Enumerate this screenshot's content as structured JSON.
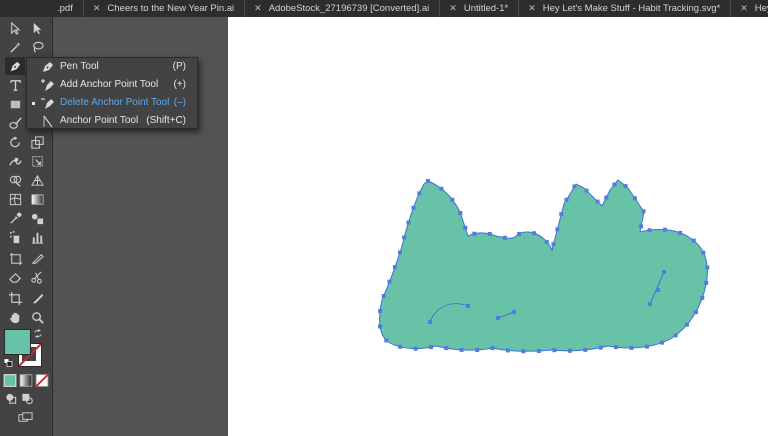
{
  "tabs": [
    {
      "label": ".pdf"
    },
    {
      "label": "Cheers to the New Year Pin.ai"
    },
    {
      "label": "AdobeStock_27196739 [Converted].ai"
    },
    {
      "label": "Untitled-1*"
    },
    {
      "label": "Hey Let's Make Stuff - Habit Tracking.svg*"
    },
    {
      "label": "Hey Let's Make Stuff - File Fold"
    }
  ],
  "tab_close_glyph": "✕",
  "flyout": {
    "items": [
      {
        "label": "Pen Tool",
        "shortcut": "(P)",
        "icon": "pen-icon"
      },
      {
        "label": "Add Anchor Point Tool",
        "shortcut": "(+)",
        "icon": "pen-plus-icon"
      },
      {
        "label": "Delete Anchor Point Tool",
        "shortcut": "(–)",
        "icon": "pen-minus-icon",
        "highlighted": true
      },
      {
        "label": "Anchor Point Tool",
        "shortcut": "(Shift+C)",
        "icon": "anchor-point-icon"
      }
    ]
  },
  "colors": {
    "fill": "#68c2a8",
    "anchor": "#4f7ee0",
    "path": "#3d6fd6",
    "highlight_text": "#5ea8ee"
  }
}
